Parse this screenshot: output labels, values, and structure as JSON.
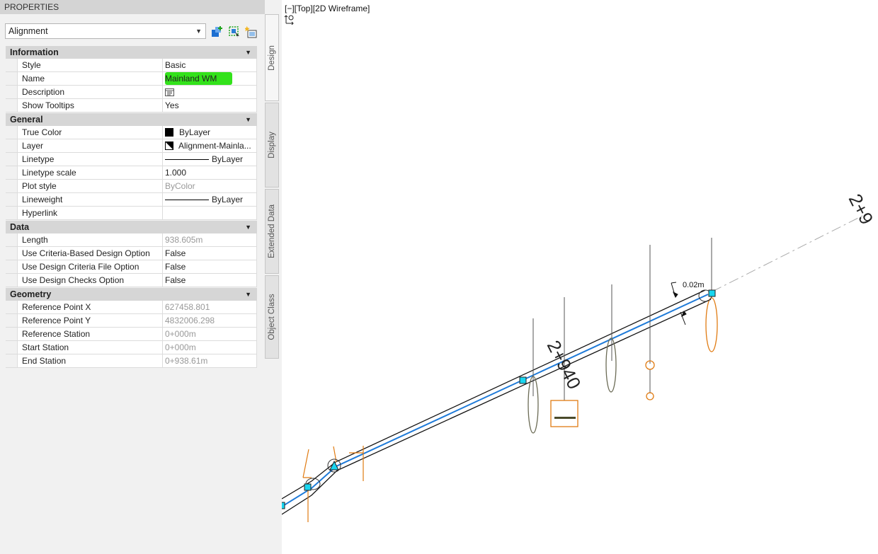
{
  "palette": {
    "title": "PROPERTIES",
    "object_type": "Alignment",
    "toolbar_icons": [
      "add-to-selection-icon",
      "select-objects-icon",
      "quick-select-icon"
    ],
    "tabs": [
      "Design",
      "Display",
      "Extended Data",
      "Object Class"
    ],
    "categories": [
      {
        "name": "Information",
        "rows": [
          {
            "label": "Style",
            "value": "Basic"
          },
          {
            "label": "Name",
            "value": "Mainland WM"
          },
          {
            "label": "Description",
            "icon": "text-editor-icon"
          },
          {
            "label": "Show Tooltips",
            "value": "Yes"
          }
        ]
      },
      {
        "name": "General",
        "rows": [
          {
            "label": "True Color",
            "value": "ByLayer",
            "swatch": "#000000"
          },
          {
            "label": "Layer",
            "value": "Alignment-Mainla..."
          },
          {
            "label": "Linetype",
            "value": "ByLayer"
          },
          {
            "label": "Linetype scale",
            "value": "1.000"
          },
          {
            "label": "Plot style",
            "value": "ByColor"
          },
          {
            "label": "Lineweight",
            "value": "ByLayer"
          },
          {
            "label": "Hyperlink",
            "value": ""
          }
        ]
      },
      {
        "name": "Data",
        "rows": [
          {
            "label": "Length",
            "value": "938.605m"
          },
          {
            "label": "Use Criteria-Based Design Option",
            "value": "False"
          },
          {
            "label": "Use Design Criteria File Option",
            "value": "False"
          },
          {
            "label": "Use Design Checks Option",
            "value": "False"
          }
        ]
      },
      {
        "name": "Geometry",
        "rows": [
          {
            "label": "Reference Point X",
            "value": "627458.801"
          },
          {
            "label": "Reference Point Y",
            "value": "4832006.298"
          },
          {
            "label": "Reference Station",
            "value": "0+000m"
          },
          {
            "label": "Start Station",
            "value": "0+000m"
          },
          {
            "label": "End Station",
            "value": "0+938.61m"
          }
        ]
      }
    ]
  },
  "viewport": {
    "label": "[−][Top][2D Wireframe]",
    "station_label": "2+940",
    "station_label_partial": "2+9",
    "dimension": "0.02m",
    "colors": {
      "alignment": "#1e7ad8",
      "pipe": "#111111",
      "structure": "#e07b12",
      "grip": "#19d6f0"
    }
  }
}
